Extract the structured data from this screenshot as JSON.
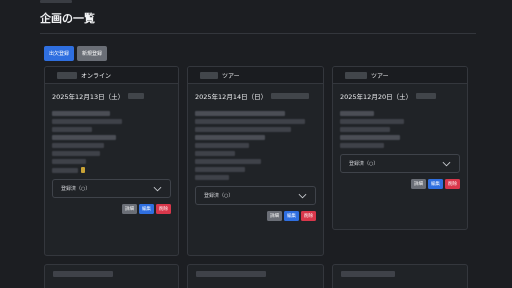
{
  "page": {
    "title": "企画の一覧"
  },
  "toolbar": {
    "attendance_label": "出欠登録",
    "new_label": "新規登録"
  },
  "events": [
    {
      "type": "オンライン",
      "date": "2025年12月13日（土）",
      "status": "登録済（○）",
      "detail_label": "詳細",
      "edit_label": "編集",
      "delete_label": "削除"
    },
    {
      "type": "ツアー",
      "date": "2025年12月14日（日）",
      "status": "登録済（○）",
      "detail_label": "詳細",
      "edit_label": "編集",
      "delete_label": "削除"
    },
    {
      "type": "ツアー",
      "date": "2025年12月20日（土）",
      "status": "登録済（○）",
      "detail_label": "詳細",
      "edit_label": "編集",
      "delete_label": "削除"
    }
  ],
  "colors": {
    "background": "#1c1e22",
    "card": "#202327",
    "primary": "#2f6fe0",
    "secondary": "#6a6e76",
    "danger": "#d9374b",
    "accent": "#c9a336"
  },
  "icons": {
    "select": "chevron-down-icon"
  }
}
